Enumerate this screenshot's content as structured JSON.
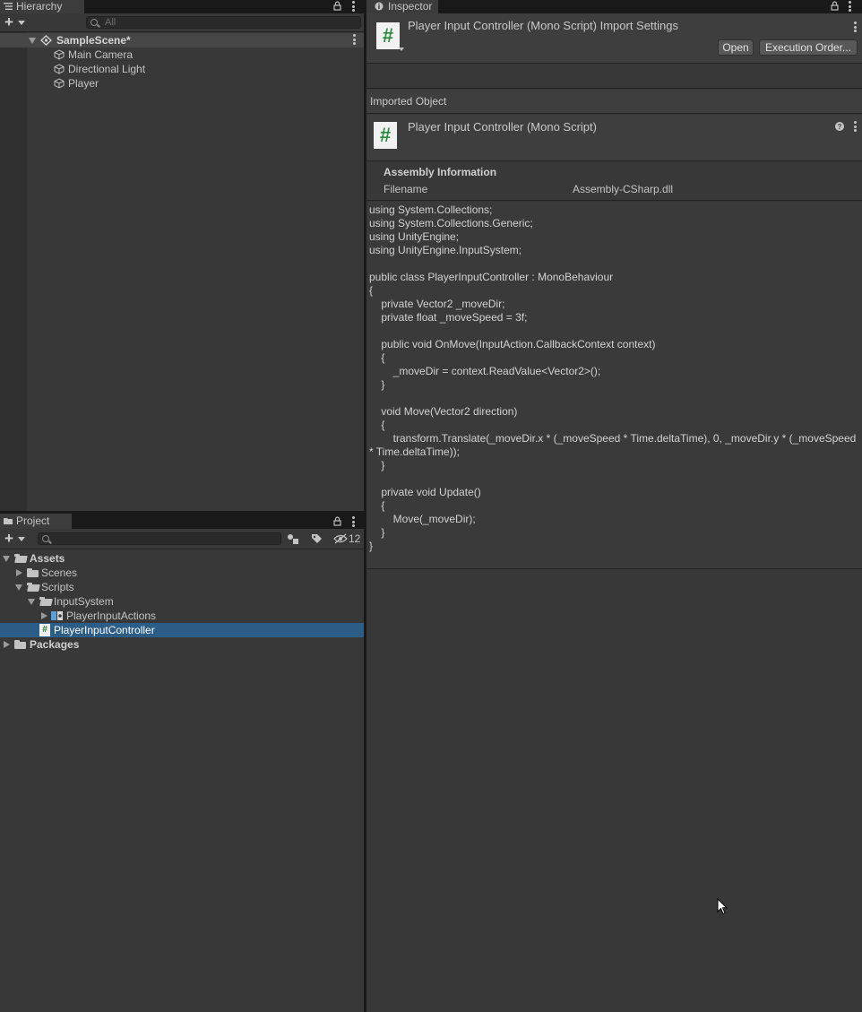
{
  "hierarchy": {
    "tab_label": "Hierarchy",
    "search_placeholder": "All",
    "scene_name": "SampleScene*",
    "items": [
      {
        "label": "Main Camera"
      },
      {
        "label": "Directional Light"
      },
      {
        "label": "Player"
      }
    ]
  },
  "project": {
    "tab_label": "Project",
    "search_placeholder": "",
    "hidden_count": "12",
    "tree": {
      "assets": "Assets",
      "scenes": "Scenes",
      "scripts": "Scripts",
      "input_system": "InputSystem",
      "player_input_actions": "PlayerInputActions",
      "player_input_controller": "PlayerInputController",
      "packages": "Packages"
    }
  },
  "inspector": {
    "tab_label": "Inspector",
    "header_title": "Player Input Controller (Mono Script) Import Settings",
    "open_button": "Open",
    "execution_order_button": "Execution Order...",
    "imported_object_label": "Imported Object",
    "object_title": "Player Input Controller (Mono Script)",
    "assembly_info_title": "Assembly Information",
    "filename_label": "Filename",
    "filename_value": "Assembly-CSharp.dll",
    "code": "using System.Collections;\nusing System.Collections.Generic;\nusing UnityEngine;\nusing UnityEngine.InputSystem;\n\npublic class PlayerInputController : MonoBehaviour\n{\n    private Vector2 _moveDir;\n    private float _moveSpeed = 3f;\n\n    public void OnMove(InputAction.CallbackContext context)\n    {\n        _moveDir = context.ReadValue<Vector2>();\n    }\n\n    void Move(Vector2 direction)\n    {\n        transform.Translate(_moveDir.x * (_moveSpeed * Time.deltaTime), 0, _moveDir.y * (_moveSpeed * Time.deltaTime));\n    }\n\n    private void Update()\n    {\n        Move(_moveDir);\n    }\n}"
  },
  "icons": {
    "script_glyph": "#",
    "accent_selection": "#2c5d87"
  }
}
